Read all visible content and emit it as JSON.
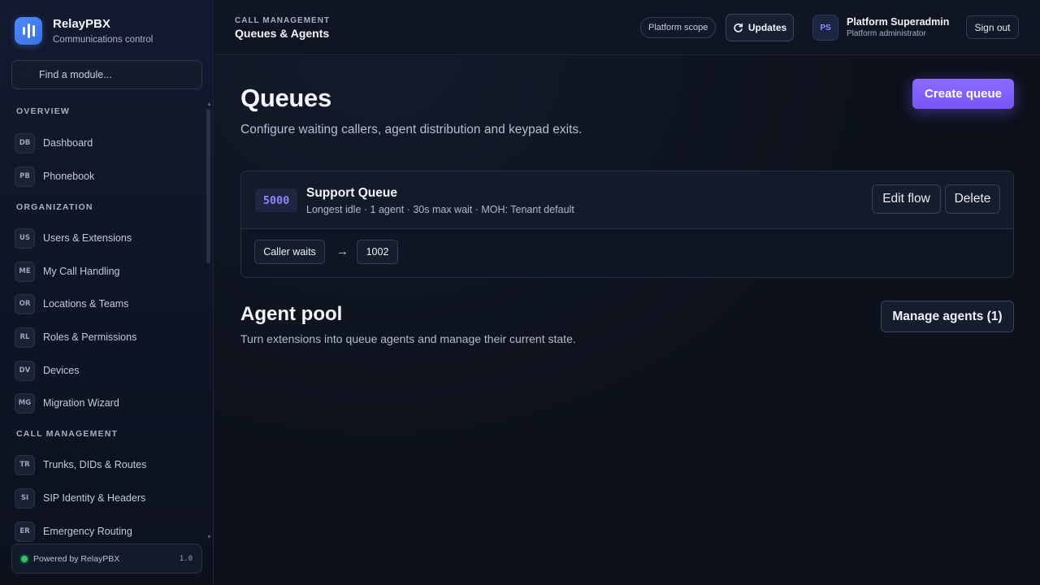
{
  "app": {
    "name": "RelayPBX",
    "tagline": "Communications control"
  },
  "search": {
    "placeholder": "Find a module..."
  },
  "sidebar": {
    "sections": [
      {
        "title": "OVERVIEW",
        "items": [
          {
            "code": "DB",
            "label": "Dashboard"
          },
          {
            "code": "PB",
            "label": "Phonebook"
          }
        ]
      },
      {
        "title": "ORGANIZATION",
        "items": [
          {
            "code": "US",
            "label": "Users & Extensions"
          },
          {
            "code": "ME",
            "label": "My Call Handling"
          },
          {
            "code": "OR",
            "label": "Locations & Teams"
          },
          {
            "code": "RL",
            "label": "Roles & Permissions"
          },
          {
            "code": "DV",
            "label": "Devices"
          },
          {
            "code": "MG",
            "label": "Migration Wizard"
          }
        ]
      },
      {
        "title": "CALL MANAGEMENT",
        "items": [
          {
            "code": "TR",
            "label": "Trunks, DIDs & Routes"
          },
          {
            "code": "SI",
            "label": "SIP Identity & Headers"
          },
          {
            "code": "ER",
            "label": "Emergency Routing"
          }
        ]
      }
    ],
    "footer": {
      "label": "Powered by RelayPBX",
      "version": "1.0"
    }
  },
  "header": {
    "section": "CALL MANAGEMENT",
    "title": "Queues & Agents",
    "scope": "Platform scope",
    "updates_label": "Updates",
    "user": {
      "initials": "PS",
      "name": "Platform Superadmin",
      "role": "Platform administrator"
    },
    "signout_label": "Sign out"
  },
  "main": {
    "title": "Queues",
    "subtitle": "Configure waiting callers, agent distribution and keypad exits.",
    "create_label": "Create queue",
    "queue": {
      "number": "5000",
      "name": "Support Queue",
      "meta": "Longest idle · 1 agent · 30s max wait · MOH: Tenant default",
      "edit_label": "Edit flow",
      "delete_label": "Delete",
      "flow": {
        "start": "Caller waits",
        "arrow": "→",
        "target": "1002"
      }
    },
    "pool": {
      "title": "Agent pool",
      "subtitle": "Turn extensions into queue agents and manage their current state.",
      "manage_label": "Manage agents (1)"
    }
  },
  "colors": {
    "accent": "#7c5cfa",
    "brand": "#4a84f7",
    "status_online": "#2fc46b"
  }
}
